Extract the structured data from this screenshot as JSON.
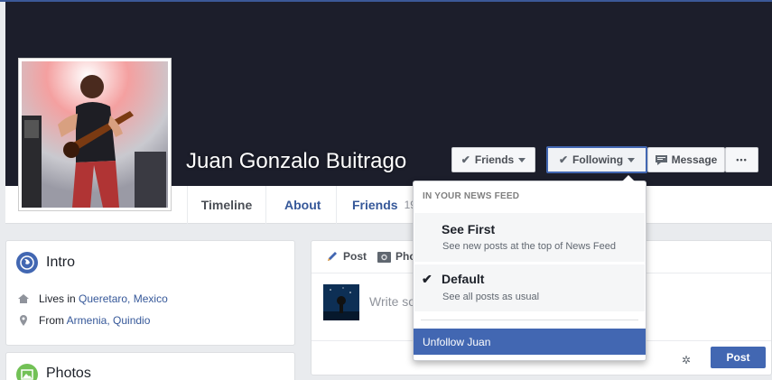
{
  "profile": {
    "name": "Juan Gonzalo Buitrago"
  },
  "header_buttons": {
    "friends_label": "Friends",
    "following_label": "Following",
    "message_label": "Message",
    "more_label": "•••"
  },
  "tabs": {
    "timeline": "Timeline",
    "about": "About",
    "friends": "Friends",
    "friends_count": "19"
  },
  "intro": {
    "title": "Intro",
    "lives_prefix": "Lives in ",
    "lives_city": "Queretaro, Mexico",
    "from_prefix": "From ",
    "from_city": "Armenia, Quindio"
  },
  "photos": {
    "title": "Photos"
  },
  "composer": {
    "post_tab": "Post",
    "photo_tab": "Pho",
    "placeholder": "Write so",
    "post_button": "Post"
  },
  "dropdown": {
    "header": "IN YOUR NEWS FEED",
    "see_first_title": "See First",
    "see_first_desc": "See new posts at the top of News Feed",
    "default_title": "Default",
    "default_desc": "See all posts as usual",
    "unfollow_label": "Unfollow Juan"
  },
  "colors": {
    "brand_blue": "#4267b2",
    "link_blue": "#365899",
    "cover_dark": "#1c1e2b",
    "page_bg": "#e9ebee"
  }
}
